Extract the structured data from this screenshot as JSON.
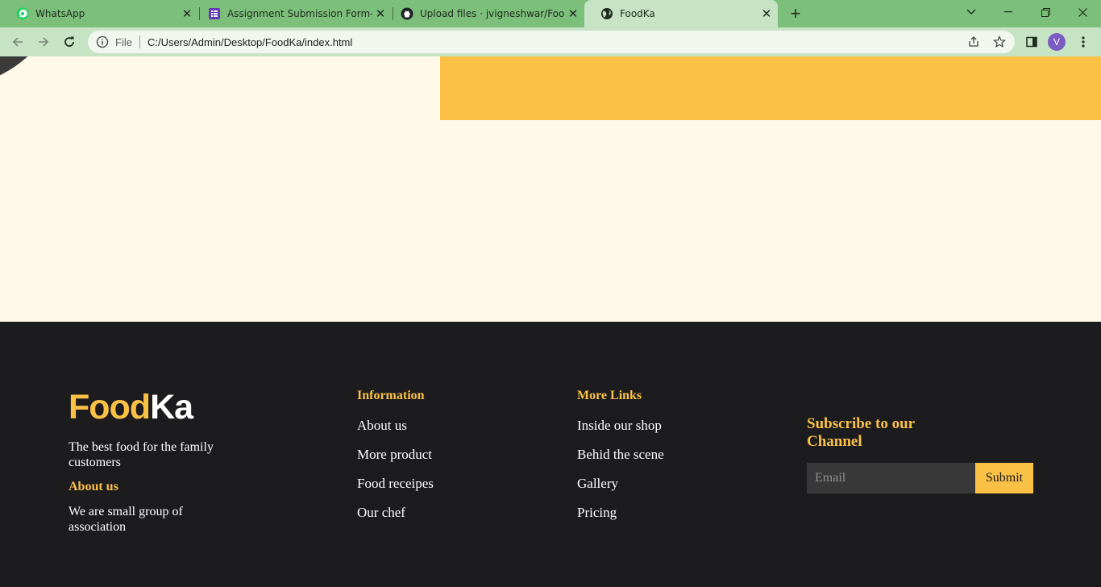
{
  "browser": {
    "tabs": [
      {
        "title": "WhatsApp",
        "icon": "whatsapp-icon",
        "active": false
      },
      {
        "title": "Assignment Submission Form-Wo",
        "icon": "forms-icon",
        "active": false
      },
      {
        "title": "Upload files · jvigneshwar/FoodKa",
        "icon": "github-icon",
        "active": false
      },
      {
        "title": "FoodKa",
        "icon": "globe-icon",
        "active": true
      }
    ],
    "address": {
      "scheme_label": "File",
      "url": "C:/Users/Admin/Desktop/FoodKa/index.html"
    },
    "profile_initial": "V",
    "tabbar_color": "#7bbf7a",
    "toolbar_color": "#c6e4c4"
  },
  "page": {
    "background": "#fff9e8",
    "accent": "#fbc146"
  },
  "footer": {
    "logo": {
      "part1": "Food",
      "part2": "Ka"
    },
    "tagline": "The best food for the family customers",
    "about_title": "About us",
    "about_text": "We are small group of association",
    "information": {
      "title": "Information",
      "links": [
        "About us",
        "More product",
        "Food receipes",
        "Our chef"
      ]
    },
    "more_links": {
      "title": "More Links",
      "links": [
        "Inside our shop",
        "Behid the scene",
        "Gallery",
        "Pricing"
      ]
    },
    "subscribe": {
      "title": "Subscribe to our Channel",
      "email_placeholder": "Email",
      "submit_label": "Submit"
    },
    "background": "#1c1c1e"
  }
}
